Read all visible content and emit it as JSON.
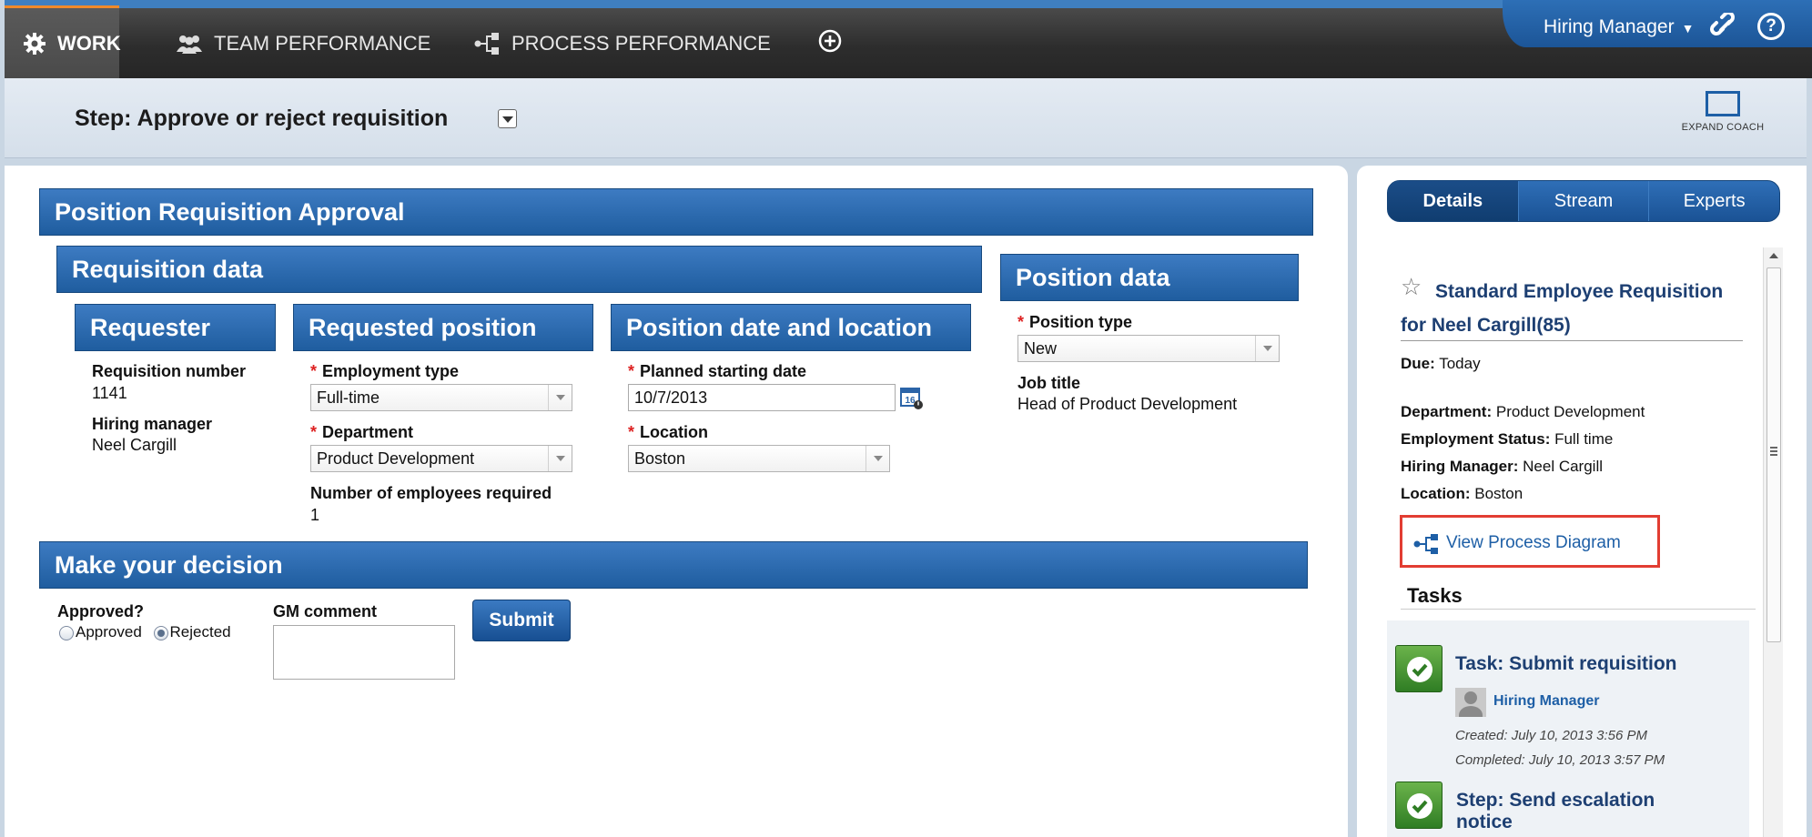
{
  "nav": {
    "work": "WORK",
    "team_performance": "TEAM PERFORMANCE",
    "process_performance": "PROCESS PERFORMANCE",
    "user": "Hiring Manager"
  },
  "step": {
    "title": "Step: Approve or reject requisition",
    "expand_label": "EXPAND COACH"
  },
  "form": {
    "title": "Position Requisition Approval",
    "requisition_data": "Requisition data",
    "requester": {
      "heading": "Requester",
      "req_number_label": "Requisition number",
      "req_number_value": "1141",
      "hiring_manager_label": "Hiring manager",
      "hiring_manager_value": "Neel Cargill"
    },
    "requested_position": {
      "heading": "Requested position",
      "employment_type_label": "Employment type",
      "employment_type_value": "Full-time",
      "department_label": "Department",
      "department_value": "Product Development",
      "num_employees_label": "Number of employees required",
      "num_employees_value": "1"
    },
    "date_location": {
      "heading": "Position date and location",
      "start_date_label": "Planned starting date",
      "start_date_value": "10/7/2013",
      "calendar_badge": "16",
      "location_label": "Location",
      "location_value": "Boston"
    },
    "position_data": {
      "heading": "Position data",
      "position_type_label": "Position type",
      "position_type_value": "New",
      "job_title_label": "Job title",
      "job_title_value": "Head of Product Development"
    },
    "decision": {
      "heading": "Make your decision",
      "approved_label": "Approved?",
      "option_approved": "Approved",
      "option_rejected": "Rejected",
      "comment_label": "GM comment",
      "submit": "Submit"
    }
  },
  "details": {
    "tabs": [
      "Details",
      "Stream",
      "Experts"
    ],
    "title": "Standard Employee Requisition for Neel Cargill(85)",
    "due_label": "Due:",
    "due_value": "Today",
    "department_label": "Department:",
    "department_value": "Product Development",
    "employment_label": "Employment Status:",
    "employment_value": "Full time",
    "manager_label": "Hiring Manager:",
    "manager_value": "Neel Cargill",
    "location_label": "Location:",
    "location_value": "Boston",
    "view_diagram": "View Process Diagram",
    "tasks_heading": "Tasks",
    "tasks": [
      {
        "title": "Task: Submit requisition",
        "user": "Hiring Manager",
        "created": "Created: July 10, 2013 3:56 PM",
        "completed": "Completed: July 10, 2013 3:57 PM"
      },
      {
        "title": "Step: Send escalation notice"
      }
    ]
  }
}
